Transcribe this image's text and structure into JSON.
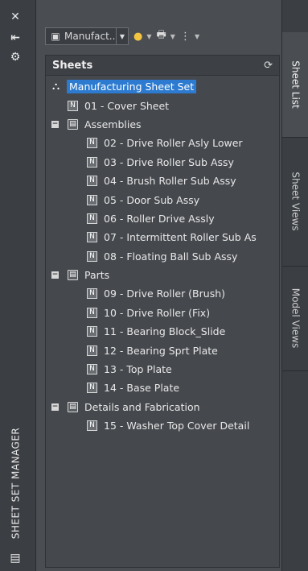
{
  "palette": {
    "title": "SHEET SET MANAGER",
    "icons": [
      "close-icon",
      "auto-hide-icon",
      "properties-icon"
    ]
  },
  "toolbar": {
    "sheet_set_dropdown": "Manufact...",
    "buttons": [
      "publish-icon",
      "plot-icon",
      "model-view-icon"
    ]
  },
  "sheets_panel": {
    "header": "Sheets",
    "tree": [
      {
        "level": 0,
        "type": "set",
        "label": "Manufacturing Sheet Set",
        "selected": true
      },
      {
        "level": 1,
        "type": "sheet",
        "label": "01 - Cover Sheet"
      },
      {
        "level": 1,
        "type": "subset",
        "label": "Assemblies",
        "expanded": true
      },
      {
        "level": 2,
        "type": "sheet",
        "label": "02 - Drive Roller Asly Lower"
      },
      {
        "level": 2,
        "type": "sheet",
        "label": "03 - Drive Roller Sub Assy"
      },
      {
        "level": 2,
        "type": "sheet",
        "label": "04 - Brush Roller Sub Assy"
      },
      {
        "level": 2,
        "type": "sheet",
        "label": "05 - Door Sub Assy"
      },
      {
        "level": 2,
        "type": "sheet",
        "label": "06 - Roller Drive Assly"
      },
      {
        "level": 2,
        "type": "sheet",
        "label": "07 - Intermittent Roller Sub As"
      },
      {
        "level": 2,
        "type": "sheet",
        "label": "08 - Floating Ball Sub Assy"
      },
      {
        "level": 1,
        "type": "subset",
        "label": "Parts",
        "expanded": true
      },
      {
        "level": 2,
        "type": "sheet",
        "label": "09 - Drive Roller (Brush)"
      },
      {
        "level": 2,
        "type": "sheet",
        "label": "10 - Drive Roller (Fix)"
      },
      {
        "level": 2,
        "type": "sheet",
        "label": "11 - Bearing Block_Slide"
      },
      {
        "level": 2,
        "type": "sheet",
        "label": "12 - Bearing Sprt Plate"
      },
      {
        "level": 2,
        "type": "sheet",
        "label": "13 - Top Plate"
      },
      {
        "level": 2,
        "type": "sheet",
        "label": "14 - Base Plate"
      },
      {
        "level": 1,
        "type": "subset",
        "label": "Details and Fabrication",
        "expanded": true
      },
      {
        "level": 2,
        "type": "sheet",
        "label": "15 - Washer Top Cover Detail"
      }
    ]
  },
  "tabs": [
    {
      "label": "Sheet List",
      "active": true
    },
    {
      "label": "Sheet Views",
      "active": false
    },
    {
      "label": "Model Views",
      "active": false
    }
  ],
  "colors": {
    "selection": "#2d7bd0",
    "panel_bg": "#45484d"
  }
}
